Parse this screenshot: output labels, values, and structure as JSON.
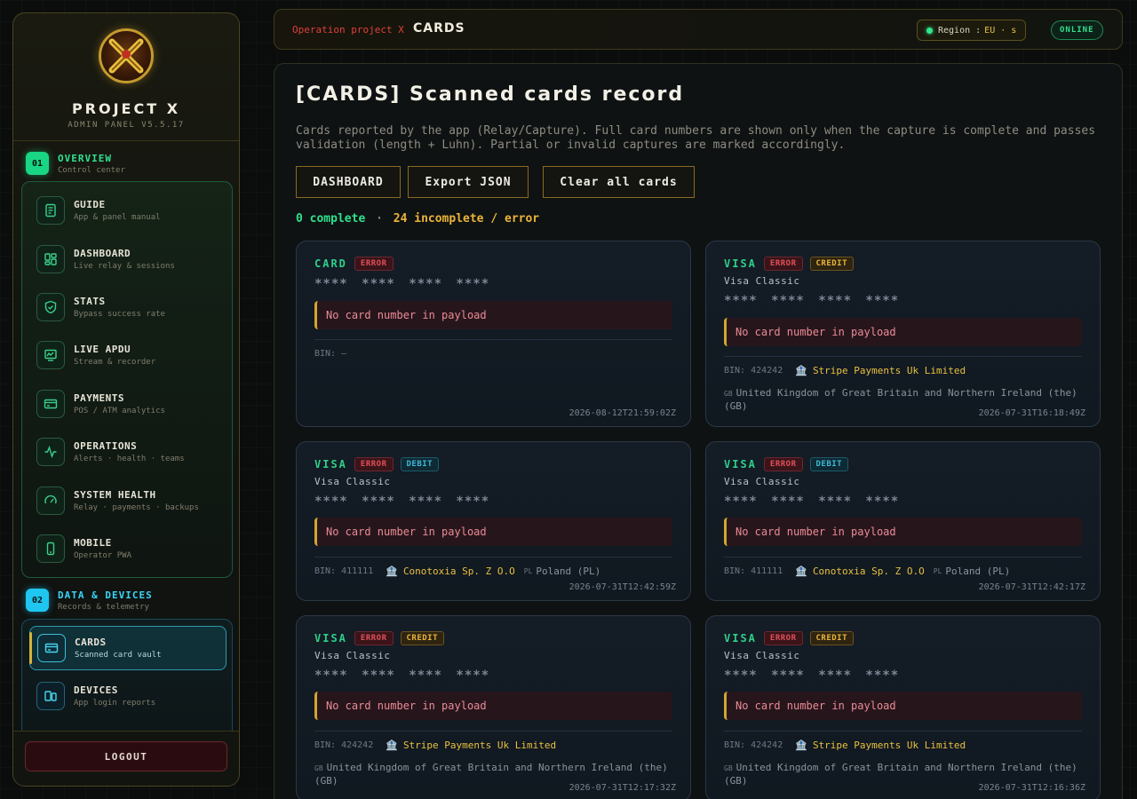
{
  "colors": {
    "accent_green": "#2ee08e",
    "accent_cyan": "#3cd4f6",
    "accent_gold": "#e8c040",
    "error_red": "#e0505a"
  },
  "sidebar": {
    "brand_title": "PROJECT X",
    "brand_sub": "ADMIN PANEL V5.5.17",
    "sections": [
      {
        "badge": "01",
        "title": "OVERVIEW",
        "sub": "Control center"
      },
      {
        "badge": "02",
        "title": "DATA & DEVICES",
        "sub": "Records & telemetry"
      }
    ],
    "overview_items": [
      {
        "label": "GUIDE",
        "sub": "App & panel manual",
        "icon": "book-icon"
      },
      {
        "label": "DASHBOARD",
        "sub": "Live relay & sessions",
        "icon": "dashboard-icon"
      },
      {
        "label": "STATS",
        "sub": "Bypass success rate",
        "icon": "shield-icon"
      },
      {
        "label": "LIVE APDU",
        "sub": "Stream & recorder",
        "icon": "monitor-icon"
      },
      {
        "label": "PAYMENTS",
        "sub": "POS / ATM analytics",
        "icon": "credit-card-icon"
      },
      {
        "label": "OPERATIONS",
        "sub": "Alerts · health · teams",
        "icon": "pulse-icon"
      },
      {
        "label": "SYSTEM HEALTH",
        "sub": "Relay · payments · backups",
        "icon": "gauge-icon"
      },
      {
        "label": "MOBILE",
        "sub": "Operator PWA",
        "icon": "phone-icon"
      }
    ],
    "data_items": [
      {
        "label": "CARDS",
        "sub": "Scanned card vault",
        "icon": "card-icon"
      },
      {
        "label": "DEVICES",
        "sub": "App login reports",
        "icon": "devices-icon"
      }
    ],
    "logout_label": "LOGOUT"
  },
  "topbar": {
    "crumb_small": "Operation project X",
    "crumb_big": "CARDS",
    "region_label": "Region :",
    "region_value": "EU · s",
    "status": "ONLINE"
  },
  "main": {
    "title": "[CARDS] Scanned cards record",
    "description": "Cards reported by the app (Relay/Capture). Full card numbers are shown only when the capture is complete and passes validation (length + Luhn). Partial or invalid captures are marked accordingly.",
    "buttons": {
      "dashboard": "DASHBOARD",
      "export": "Export JSON",
      "clear": "Clear all cards"
    },
    "summary": {
      "complete": "0 complete",
      "sep": "·",
      "incomplete": "24 incomplete / error"
    }
  },
  "cards": [
    {
      "brand": "CARD",
      "status": "ERROR",
      "type": "",
      "product": "",
      "masked": "**** **** **** ****",
      "alert": "No card number in payload",
      "bin_label": "BIN: —",
      "bank": "",
      "country_code": "",
      "country": "",
      "country_full": "",
      "timestamp": "2026-08-12T21:59:02Z"
    },
    {
      "brand": "VISA",
      "status": "ERROR",
      "type": "CREDIT",
      "product": "Visa Classic",
      "masked": "**** **** **** ****",
      "alert": "No card number in payload",
      "bin_label": "BIN: 424242",
      "bank": "Stripe Payments Uk Limited",
      "country_code": "GB",
      "country_full": "United Kingdom of Great Britain and Northern Ireland (the) (GB)",
      "timestamp": "2026-07-31T16:18:49Z"
    },
    {
      "brand": "VISA",
      "status": "ERROR",
      "type": "DEBIT",
      "product": "Visa Classic",
      "masked": "**** **** **** ****",
      "alert": "No card number in payload",
      "bin_label": "BIN: 411111",
      "bank": "Conotoxia Sp. Z O.O",
      "country_code": "PL",
      "country": "Poland (PL)",
      "timestamp": "2026-07-31T12:42:59Z"
    },
    {
      "brand": "VISA",
      "status": "ERROR",
      "type": "DEBIT",
      "product": "Visa Classic",
      "masked": "**** **** **** ****",
      "alert": "No card number in payload",
      "bin_label": "BIN: 411111",
      "bank": "Conotoxia Sp. Z O.O",
      "country_code": "PL",
      "country": "Poland (PL)",
      "timestamp": "2026-07-31T12:42:17Z"
    },
    {
      "brand": "VISA",
      "status": "ERROR",
      "type": "CREDIT",
      "product": "Visa Classic",
      "masked": "**** **** **** ****",
      "alert": "No card number in payload",
      "bin_label": "BIN: 424242",
      "bank": "Stripe Payments Uk Limited",
      "country_code": "GB",
      "country_full": "United Kingdom of Great Britain and Northern Ireland (the) (GB)",
      "timestamp": "2026-07-31T12:17:32Z"
    },
    {
      "brand": "VISA",
      "status": "ERROR",
      "type": "CREDIT",
      "product": "Visa Classic",
      "masked": "**** **** **** ****",
      "alert": "No card number in payload",
      "bin_label": "BIN: 424242",
      "bank": "Stripe Payments Uk Limited",
      "country_code": "GB",
      "country_full": "United Kingdom of Great Britain and Northern Ireland (the) (GB)",
      "timestamp": "2026-07-31T12:16:36Z"
    }
  ]
}
